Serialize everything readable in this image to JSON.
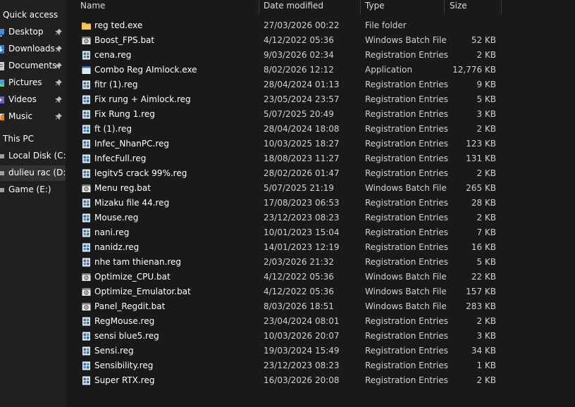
{
  "nav": {
    "quick_access": "Quick access",
    "pinned": [
      {
        "label": "Desktop",
        "icon": "desktop-icon"
      },
      {
        "label": "Downloads",
        "icon": "downloads-icon"
      },
      {
        "label": "Documents",
        "icon": "documents-icon"
      },
      {
        "label": "Pictures",
        "icon": "pictures-icon"
      },
      {
        "label": "Videos",
        "icon": "videos-icon"
      },
      {
        "label": "Music",
        "icon": "music-icon"
      }
    ],
    "this_pc": "This PC",
    "drives": [
      {
        "label": "Local Disk (C:)",
        "icon": "drive-icon"
      },
      {
        "label": "dulieu rac (D:)",
        "icon": "drive-icon",
        "selected": true
      },
      {
        "label": "Game (E:)",
        "icon": "drive-icon"
      }
    ]
  },
  "columns": {
    "name": "Name",
    "date": "Date modified",
    "type": "Type",
    "size": "Size"
  },
  "files": [
    {
      "name": "reg ted.exe",
      "date": "27/03/2026 00:22",
      "type": "File folder",
      "size": "",
      "icon": "folder-icon"
    },
    {
      "name": "Boost_FPS.bat",
      "date": "4/12/2022 05:36",
      "type": "Windows Batch File",
      "size": "52 KB",
      "icon": "batch-file-icon"
    },
    {
      "name": "cena.reg",
      "date": "9/03/2026 02:34",
      "type": "Registration Entries",
      "size": "2 KB",
      "icon": "registry-file-icon"
    },
    {
      "name": "Combo Reg AImlock.exe",
      "date": "8/02/2026 12:12",
      "type": "Application",
      "size": "12,776 KB",
      "icon": "application-icon"
    },
    {
      "name": "fitr (1).reg",
      "date": "28/04/2024 01:13",
      "type": "Registration Entries",
      "size": "9 KB",
      "icon": "registry-file-icon"
    },
    {
      "name": "Fix rung + Aimlock.reg",
      "date": "23/05/2024 23:57",
      "type": "Registration Entries",
      "size": "5 KB",
      "icon": "registry-file-icon"
    },
    {
      "name": "Fix Rung 1.reg",
      "date": "5/07/2025 20:49",
      "type": "Registration Entries",
      "size": "3 KB",
      "icon": "registry-file-icon"
    },
    {
      "name": "ft (1).reg",
      "date": "28/04/2024 18:08",
      "type": "Registration Entries",
      "size": "2 KB",
      "icon": "registry-file-icon"
    },
    {
      "name": "Infec_NhanPC.reg",
      "date": "10/03/2025 18:27",
      "type": "Registration Entries",
      "size": "123 KB",
      "icon": "registry-file-icon"
    },
    {
      "name": "InfecFull.reg",
      "date": "18/08/2023 11:27",
      "type": "Registration Entries",
      "size": "131 KB",
      "icon": "registry-file-icon"
    },
    {
      "name": "legitv5 crack 99%.reg",
      "date": "28/02/2026 01:47",
      "type": "Registration Entries",
      "size": "2 KB",
      "icon": "registry-file-icon"
    },
    {
      "name": "Menu reg.bat",
      "date": "5/07/2025 21:19",
      "type": "Windows Batch File",
      "size": "265 KB",
      "icon": "batch-file-icon"
    },
    {
      "name": "Mizaku file 44.reg",
      "date": "17/08/2023 06:53",
      "type": "Registration Entries",
      "size": "28 KB",
      "icon": "registry-file-icon"
    },
    {
      "name": "Mouse.reg",
      "date": "23/12/2023 08:23",
      "type": "Registration Entries",
      "size": "2 KB",
      "icon": "registry-file-icon"
    },
    {
      "name": "nani.reg",
      "date": "10/01/2023 15:04",
      "type": "Registration Entries",
      "size": "7 KB",
      "icon": "registry-file-icon"
    },
    {
      "name": "nanidz.reg",
      "date": "14/01/2023 12:19",
      "type": "Registration Entries",
      "size": "16 KB",
      "icon": "registry-file-icon"
    },
    {
      "name": "nhe tam thienan.reg",
      "date": "2/03/2026 21:32",
      "type": "Registration Entries",
      "size": "5 KB",
      "icon": "registry-file-icon"
    },
    {
      "name": "Optimize_CPU.bat",
      "date": "4/12/2022 05:36",
      "type": "Windows Batch File",
      "size": "22 KB",
      "icon": "batch-file-icon"
    },
    {
      "name": "Optimize_Emulator.bat",
      "date": "4/12/2022 05:36",
      "type": "Windows Batch File",
      "size": "157 KB",
      "icon": "batch-file-icon"
    },
    {
      "name": "Panel_Regdit.bat",
      "date": "8/03/2026 18:51",
      "type": "Windows Batch File",
      "size": "283 KB",
      "icon": "batch-file-icon"
    },
    {
      "name": "RegMouse.reg",
      "date": "23/04/2024 08:01",
      "type": "Registration Entries",
      "size": "2 KB",
      "icon": "registry-file-icon"
    },
    {
      "name": "sensi blue5.reg",
      "date": "10/03/2026 20:07",
      "type": "Registration Entries",
      "size": "3 KB",
      "icon": "registry-file-icon"
    },
    {
      "name": "Sensi.reg",
      "date": "19/03/2024 15:49",
      "type": "Registration Entries",
      "size": "34 KB",
      "icon": "registry-file-icon"
    },
    {
      "name": "Sensibility.reg",
      "date": "23/12/2023 08:23",
      "type": "Registration Entries",
      "size": "1 KB",
      "icon": "registry-file-icon"
    },
    {
      "name": "Super RTX.reg",
      "date": "16/03/2026 20:08",
      "type": "Registration Entries",
      "size": "2 KB",
      "icon": "registry-file-icon"
    }
  ]
}
